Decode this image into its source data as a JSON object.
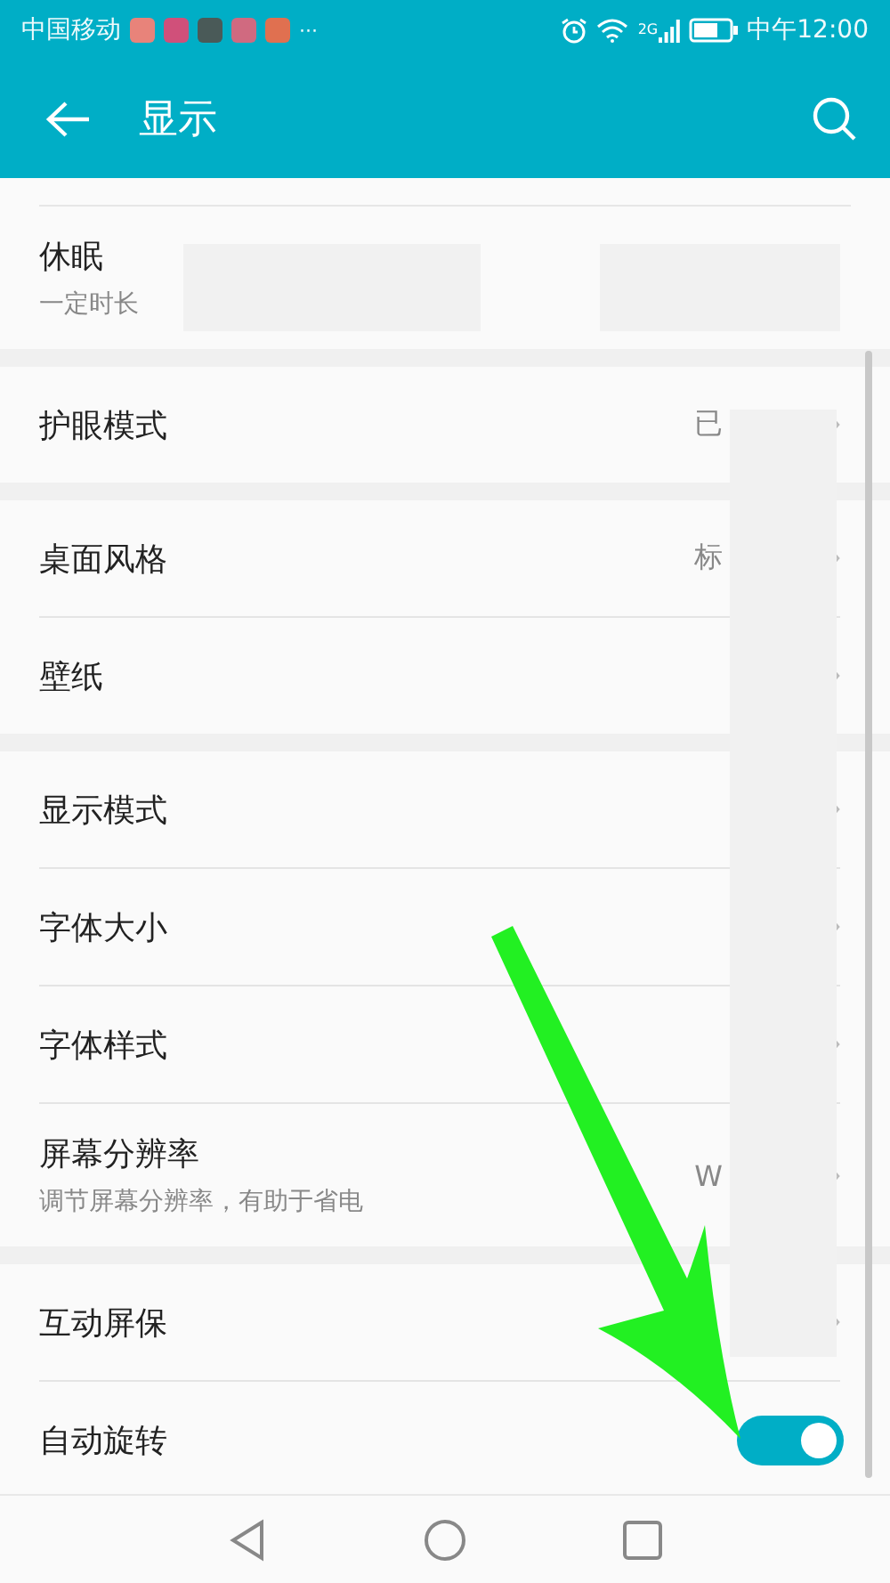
{
  "status_bar": {
    "carrier": "中国移动",
    "more": "···",
    "network": "2G",
    "time": "中午12:00"
  },
  "header": {
    "title": "显示"
  },
  "sections": [
    [
      {
        "kind": "plain",
        "title": "休眠",
        "subtitle": "一定时长"
      }
    ],
    [
      {
        "kind": "link",
        "title": "护眼模式",
        "value": "已"
      }
    ],
    [
      {
        "kind": "link",
        "title": "桌面风格",
        "value": "标"
      },
      {
        "kind": "link",
        "title": "壁纸"
      }
    ],
    [
      {
        "kind": "link",
        "title": "显示模式"
      },
      {
        "kind": "link",
        "title": "字体大小"
      },
      {
        "kind": "link",
        "title": "字体样式"
      },
      {
        "kind": "link",
        "title": "屏幕分辨率",
        "subtitle": "调节屏幕分辨率，有助于省电",
        "value": "W"
      }
    ],
    [
      {
        "kind": "link",
        "title": "互动屏保"
      },
      {
        "kind": "switch",
        "title": "自动旋转",
        "on": true
      }
    ]
  ]
}
